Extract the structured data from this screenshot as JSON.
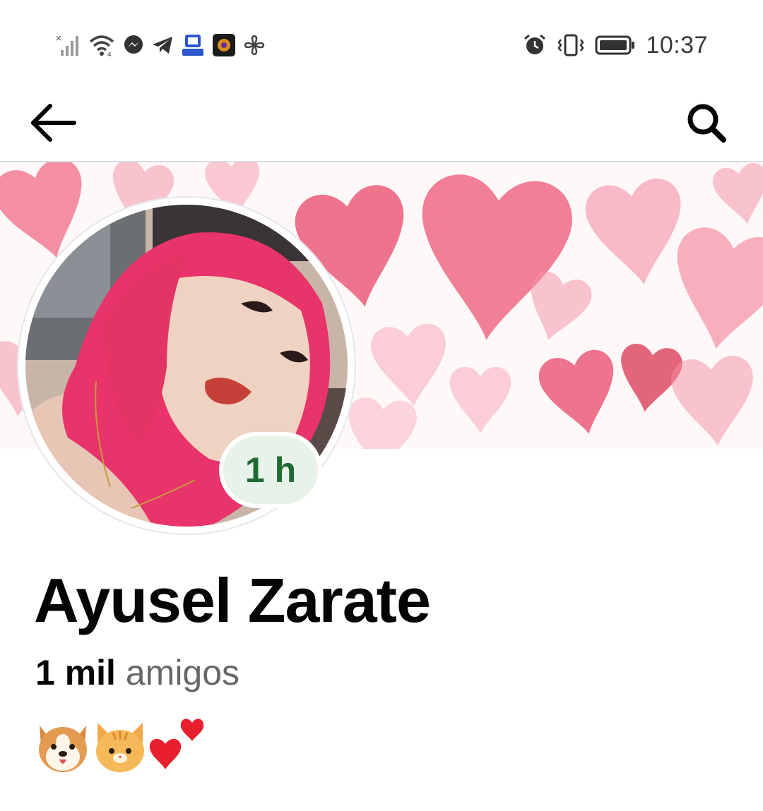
{
  "status_bar": {
    "time": "10:37",
    "left_icons": [
      "signal-off-icon",
      "wifi-icon",
      "messenger-icon",
      "telegram-icon",
      "vpn-app-icon",
      "game-app-icon",
      "pinwheel-icon"
    ],
    "right_icons": [
      "alarm-icon",
      "vibrate-icon",
      "battery-icon"
    ]
  },
  "app_bar": {
    "back_icon": "arrow-left-icon",
    "search_icon": "search-icon"
  },
  "profile": {
    "story_badge": "1 h",
    "name": "Ayusel Zarate",
    "friends_count": "1 mil",
    "friends_label": "amigos",
    "bio_emojis": [
      "dog-face-emoji",
      "cat-face-emoji",
      "two-hearts-emoji"
    ]
  },
  "colors": {
    "badge_bg": "#e7f3e8",
    "badge_text": "#1f6b33",
    "name_text": "#050505",
    "muted_text": "#65676b",
    "hair_pink": "#e8336b",
    "heart_pink": "#f06c86"
  }
}
